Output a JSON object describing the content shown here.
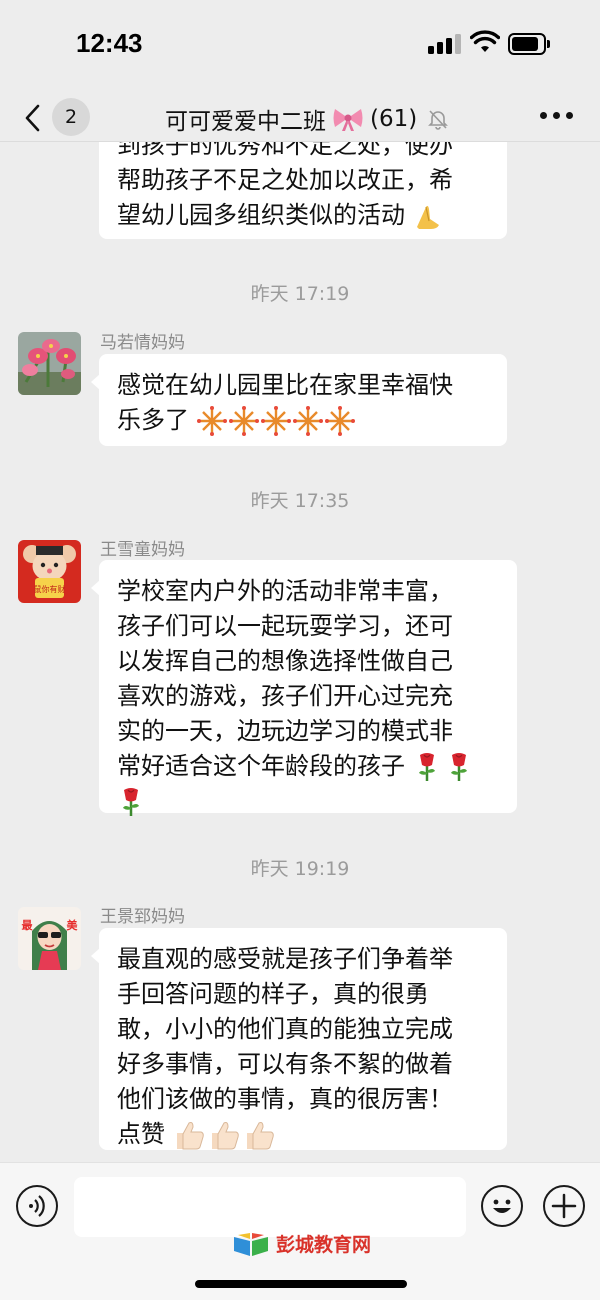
{
  "status_bar": {
    "time": "12:43"
  },
  "header": {
    "back_count": "2",
    "title": "可可爱爱中二班",
    "member_count": "(61)"
  },
  "messages": {
    "first_partial": {
      "line1": "到孩子的优秀和不足之处，使办",
      "line2": "帮助孩子不足之处加以改正，希",
      "line3": "望幼儿园多组织类似的活动"
    },
    "time1": "昨天 17:19",
    "msg1": {
      "sender": "马若情妈妈",
      "line1": "感觉在幼儿园里比在家里幸福快",
      "line2": "乐多了"
    },
    "time2": "昨天 17:35",
    "msg2": {
      "sender": "王雪童妈妈",
      "avatar_text": "鼠你有财",
      "line1": "学校室内户外的活动非常丰富，",
      "line2": "孩子们可以一起玩耍学习，还可",
      "line3": "以发挥自己的想像选择性做自己",
      "line4": "喜欢的游戏，孩子们开心过完充",
      "line5": "实的一天，边玩边学习的模式非",
      "line6": "常好适合这个年龄段的孩子"
    },
    "time3": "昨天 19:19",
    "msg3": {
      "sender": "王景郅妈妈",
      "avatar_left": "最",
      "avatar_right": "美",
      "line1": "最直观的感受就是孩子们争着举",
      "line2": "手回答问题的样子，真的很勇",
      "line3": "敢，小小的他们真的能独立完成",
      "line4": "好多事情，可以有条不絮的做着",
      "line5": "他们该做的事情，真的很厉害！",
      "line6": "点赞"
    }
  },
  "watermark": {
    "text": "彭城教育网"
  },
  "colors": {
    "background": "#ededed",
    "bubble": "#ffffff",
    "brand_red": "#d9322a"
  }
}
